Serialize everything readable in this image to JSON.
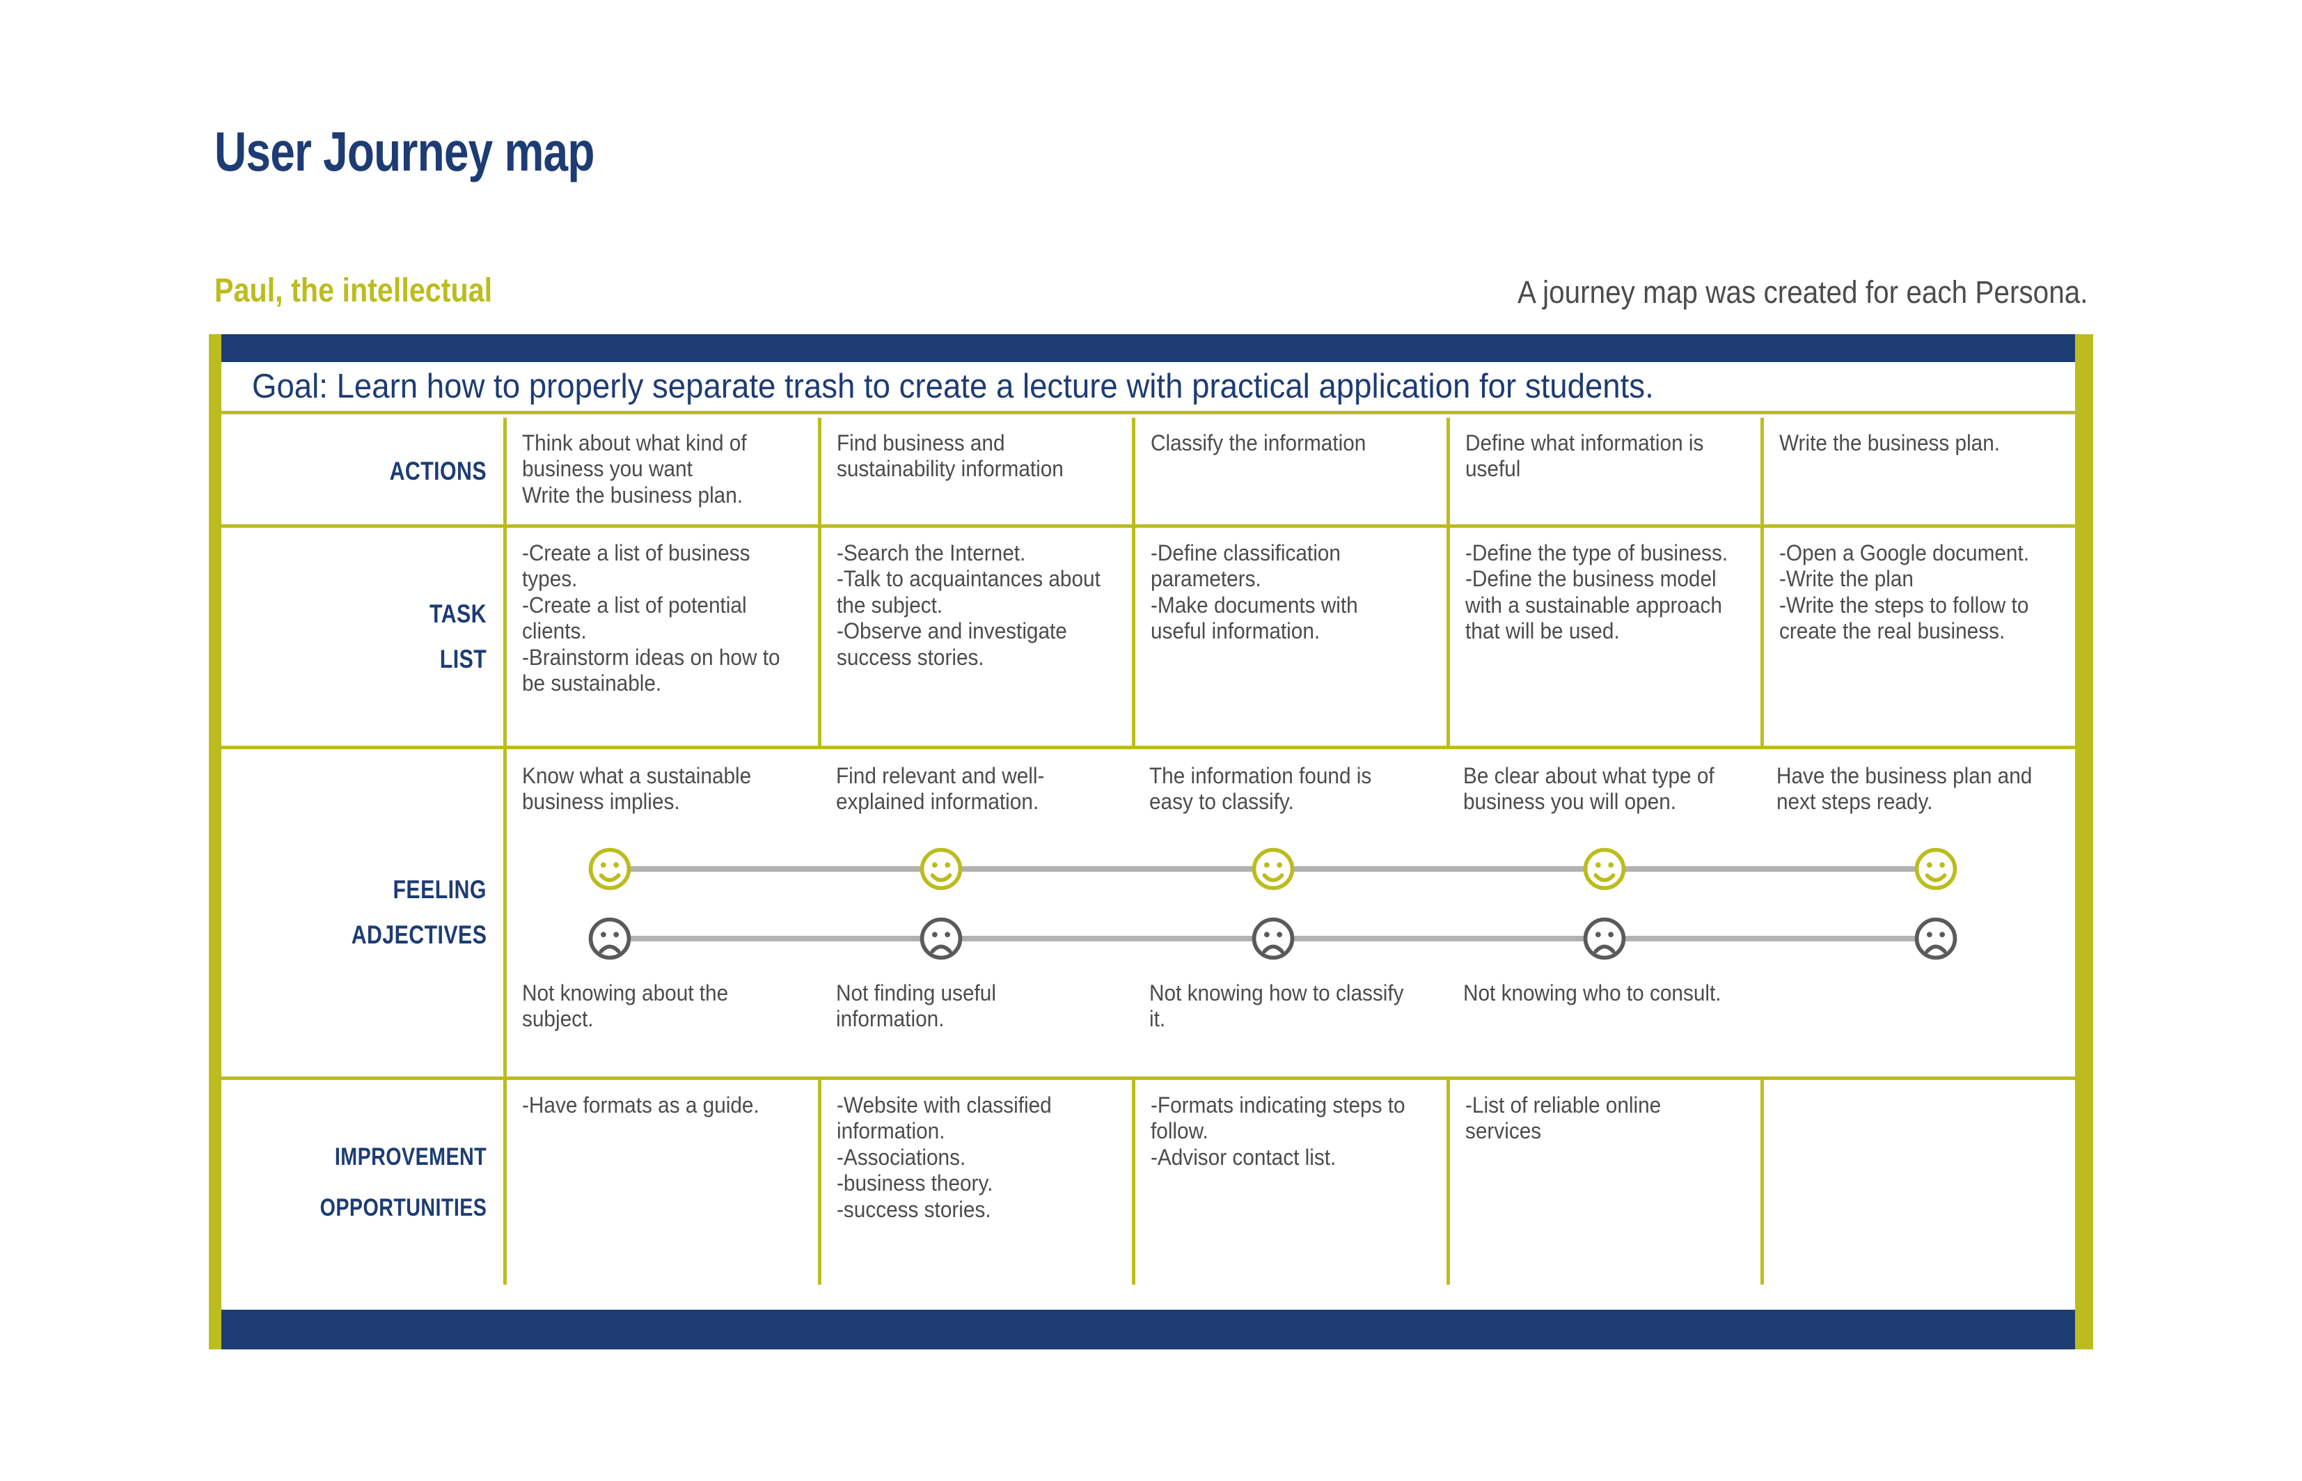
{
  "header": {
    "title": "User Journey map",
    "persona": "Paul, the intellectual",
    "note": "A journey map was created for each Persona."
  },
  "colors": {
    "navy": "#1d3c74",
    "olive": "#bcbc1e",
    "body_text": "#4c4c4c",
    "connector_gray": "#b2b2b2"
  },
  "goal": "Goal: Learn how to properly separate trash to create a lecture with practical application for students.",
  "rows": {
    "actions": {
      "label": "ACTIONS",
      "cells": [
        "Think about what kind of business you want\nWrite the business plan.",
        "Find business and sustainability information",
        "Classify the information",
        "Define what information is useful",
        "Write the business plan."
      ]
    },
    "task_list": {
      "label_line1": "TASK",
      "label_line2": "LIST",
      "cells": [
        "-Create a list of business types.\n-Create a list of potential clients.\n-Brainstorm ideas on how to be sustainable.",
        "-Search the Internet.\n-Talk to acquaintances about the subject.\n-Observe and investigate success stories.",
        "-Define classification parameters.\n-Make documents with useful information.",
        "-Define the type of business.\n-Define the business model with a sustainable approach that will be used.",
        "-Open a Google document.\n-Write the plan\n-Write the steps to follow to create the real business."
      ]
    },
    "feeling": {
      "label_line1": "FEELING",
      "label_line2": "ADJECTIVES",
      "positive": [
        "Know what a sustainable business implies.",
        "Find relevant and well-explained information.",
        "The information found is easy to classify.",
        "Be clear about what type of business you will open.",
        "Have the business plan and next steps ready."
      ],
      "negative": [
        "Not knowing about the subject.",
        "Not finding useful information.",
        "Not knowing how to classify it.",
        "Not knowing who to consult.",
        ""
      ],
      "happy_icon": "happy-face-icon",
      "sad_icon": "sad-face-icon",
      "happy_count": 5,
      "sad_count": 5
    },
    "improvement": {
      "label_line1": "IMPROVEMENT",
      "label_line2": "OPPORTUNITIES",
      "cells": [
        "-Have formats as a guide.",
        "-Website with classified information.\n-Associations.\n-business theory.\n-success stories.",
        "-Formats indicating steps to follow.\n-Advisor contact list.",
        "-List of reliable online services",
        ""
      ]
    }
  }
}
